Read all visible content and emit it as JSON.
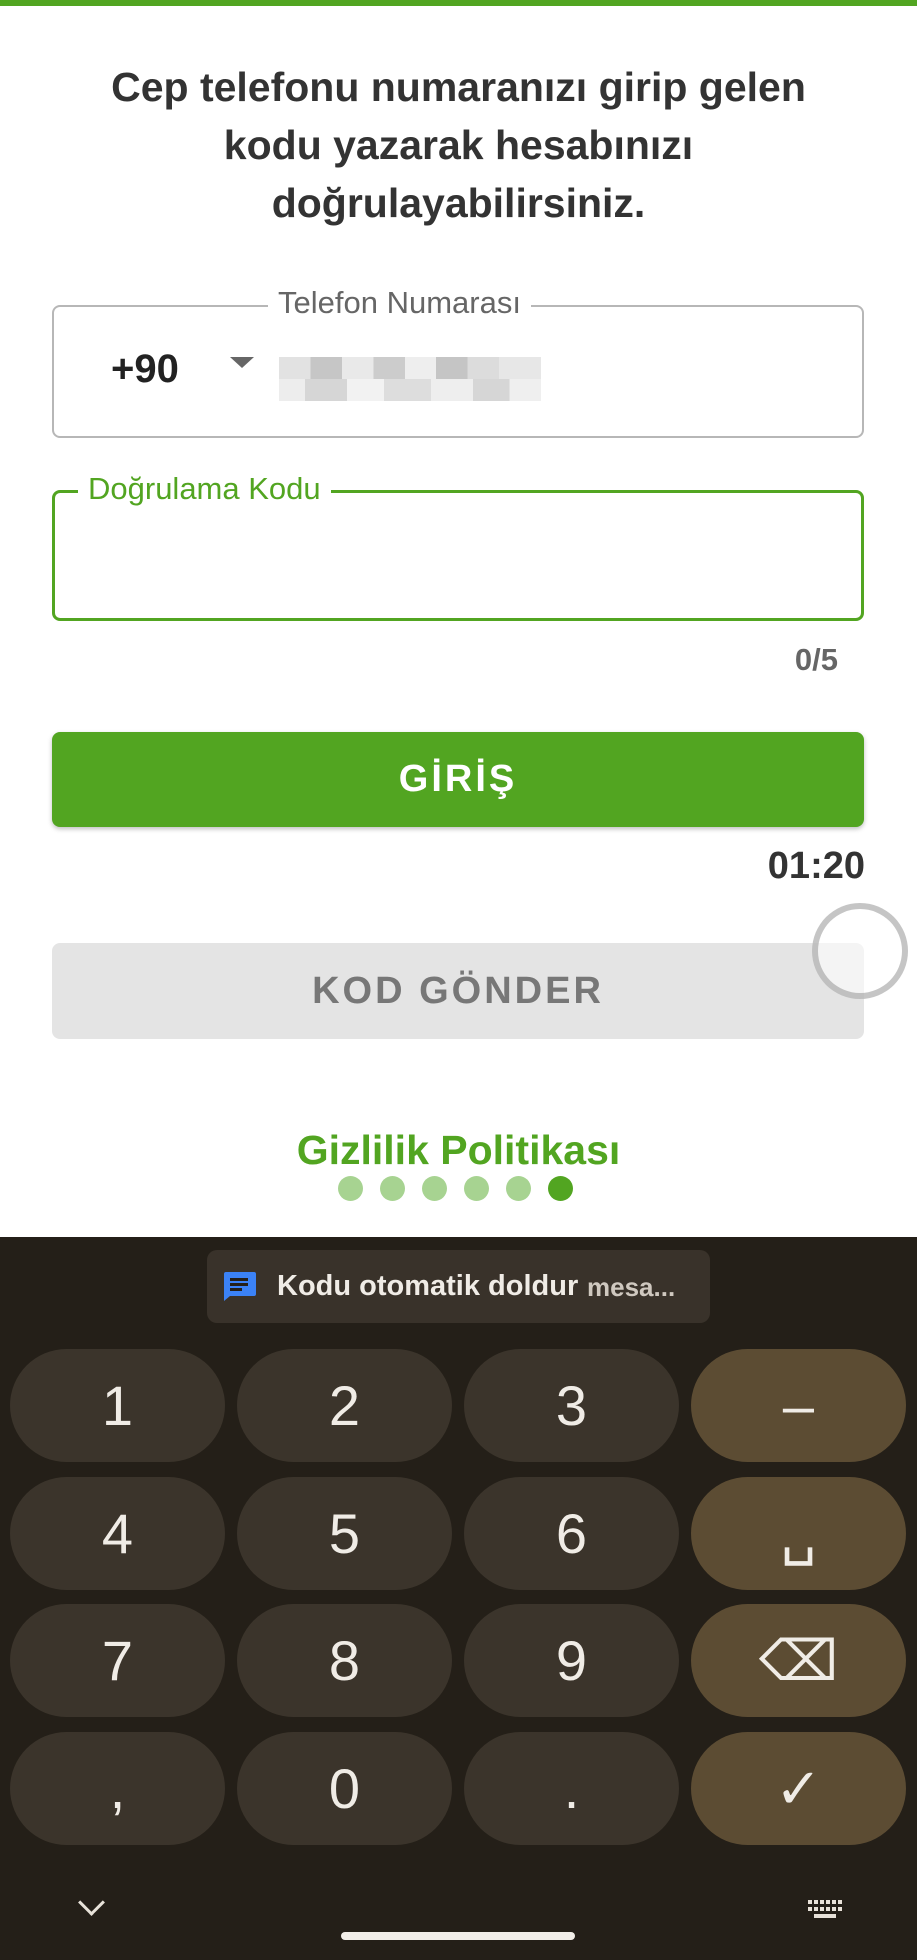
{
  "header": {
    "instruction": "Cep telefonu numaranızı girip gelen kodu yazarak hesabınızı doğrulayabilirsiniz."
  },
  "phone_field": {
    "label": "Telefon Numarası",
    "country_code": "+90",
    "value_masked": true
  },
  "code_field": {
    "label": "Doğrulama Kodu",
    "value": "",
    "counter": "0/5"
  },
  "login_button": {
    "label": "GİRİŞ"
  },
  "timer": "01:20",
  "send_code_button": {
    "label": "KOD GÖNDER",
    "enabled": false
  },
  "privacy_link": "Gizlilik Politikası",
  "pager": {
    "count": 6,
    "active_index": 5
  },
  "keyboard": {
    "suggestion": {
      "icon": "sms-icon",
      "text": "Kodu otomatik doldur",
      "sub": "mesa..."
    },
    "keys": [
      [
        "1",
        "2",
        "3",
        "–"
      ],
      [
        "4",
        "5",
        "6",
        "␣"
      ],
      [
        "7",
        "8",
        "9",
        "⌫"
      ],
      [
        ",",
        "0",
        ".",
        "✓"
      ]
    ]
  },
  "colors": {
    "accent": "#52a521",
    "accent_light": "#a7d391",
    "keyboard_bg": "#241f18",
    "key_bg": "#3b342b",
    "func_key_bg": "#5c4c33"
  }
}
